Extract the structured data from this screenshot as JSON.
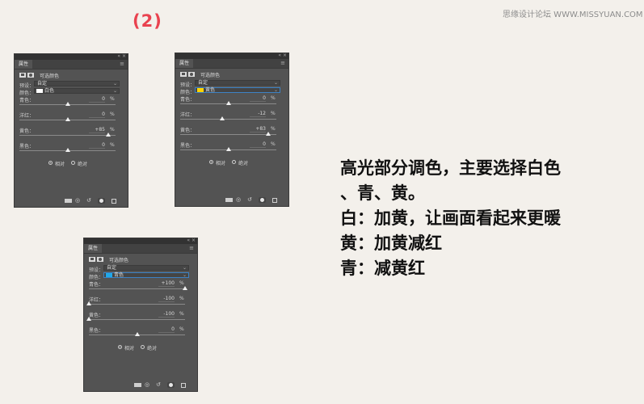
{
  "step_label": "(2)",
  "watermark": "思缘设计论坛 WWW.MISSYUAN.COM",
  "panels": [
    {
      "tab": "属性",
      "title": "可选颜色",
      "preset_label": "预设：",
      "preset_value": "自定",
      "color_label": "颜色：",
      "color_value": "白色",
      "swatch_color": "#ffffff",
      "sliders": [
        {
          "label": "青色：",
          "value": "0",
          "unit": "%",
          "level": 0
        },
        {
          "label": "洋红：",
          "value": "0",
          "unit": "%",
          "level": 0
        },
        {
          "label": "黄色：",
          "value": "+85",
          "unit": "%",
          "level": 85
        },
        {
          "label": "黑色：",
          "value": "0",
          "unit": "%",
          "level": 0
        }
      ],
      "method_relative": "相对",
      "method_absolute": "绝对"
    },
    {
      "tab": "属性",
      "title": "可选颜色",
      "preset_label": "预设：",
      "preset_value": "自定",
      "color_label": "颜色：",
      "color_value": "黄色",
      "swatch_color": "#ffd400",
      "sliders": [
        {
          "label": "青色：",
          "value": "0",
          "unit": "%",
          "level": 0
        },
        {
          "label": "洋红：",
          "value": "-12",
          "unit": "%",
          "level": -12
        },
        {
          "label": "黄色：",
          "value": "+83",
          "unit": "%",
          "level": 83
        },
        {
          "label": "黑色：",
          "value": "0",
          "unit": "%",
          "level": 0
        }
      ],
      "method_relative": "相对",
      "method_absolute": "绝对"
    },
    {
      "tab": "属性",
      "title": "可选颜色",
      "preset_label": "预设：",
      "preset_value": "自定",
      "color_label": "颜色：",
      "color_value": "青色",
      "swatch_color": "#20a8e8",
      "sliders": [
        {
          "label": "青色：",
          "value": "+100",
          "unit": "%",
          "level": 100
        },
        {
          "label": "洋红：",
          "value": "-100",
          "unit": "%",
          "level": -100
        },
        {
          "label": "黄色：",
          "value": "-100",
          "unit": "%",
          "level": -100
        },
        {
          "label": "黑色：",
          "value": "0",
          "unit": "%",
          "level": 0
        }
      ],
      "method_relative": "相对",
      "method_absolute": "绝对"
    }
  ],
  "notes": [
    "高光部分调色，主要选择白色",
    "、青、黄。",
    "白：加黄，让画面看起来更暖",
    "黄：加黄减红",
    "青：减黄红"
  ],
  "colors": {
    "step": "#e9424f",
    "panel_bg": "#535353",
    "accent_border": "#3d82c4"
  }
}
